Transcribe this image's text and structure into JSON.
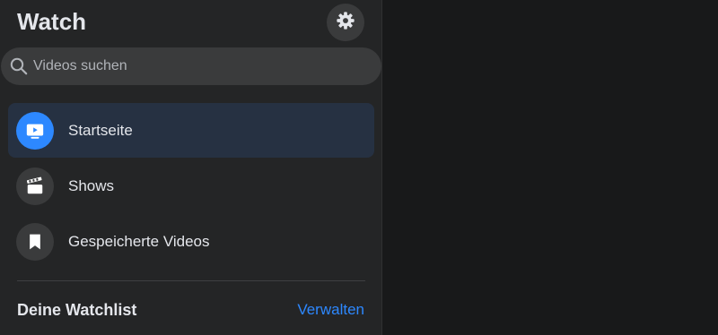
{
  "header": {
    "title": "Watch",
    "settings_icon": "gear-icon"
  },
  "search": {
    "placeholder": "Videos suchen",
    "value": "",
    "icon": "search-icon"
  },
  "nav": {
    "items": [
      {
        "label": "Startseite",
        "icon": "tv-play-icon",
        "active": true
      },
      {
        "label": "Shows",
        "icon": "clapperboard-icon",
        "active": false
      },
      {
        "label": "Gespeicherte Videos",
        "icon": "bookmark-icon",
        "active": false
      }
    ]
  },
  "watchlist": {
    "title": "Deine Watchlist",
    "manage_label": "Verwalten"
  },
  "colors": {
    "sidebar_bg": "#242526",
    "page_bg": "#18191a",
    "accent": "#2d88ff",
    "active_item_bg": "#263142",
    "icon_circle_bg": "#3a3b3c",
    "text_primary": "#e4e6eb",
    "text_secondary": "#b0b3b8"
  }
}
